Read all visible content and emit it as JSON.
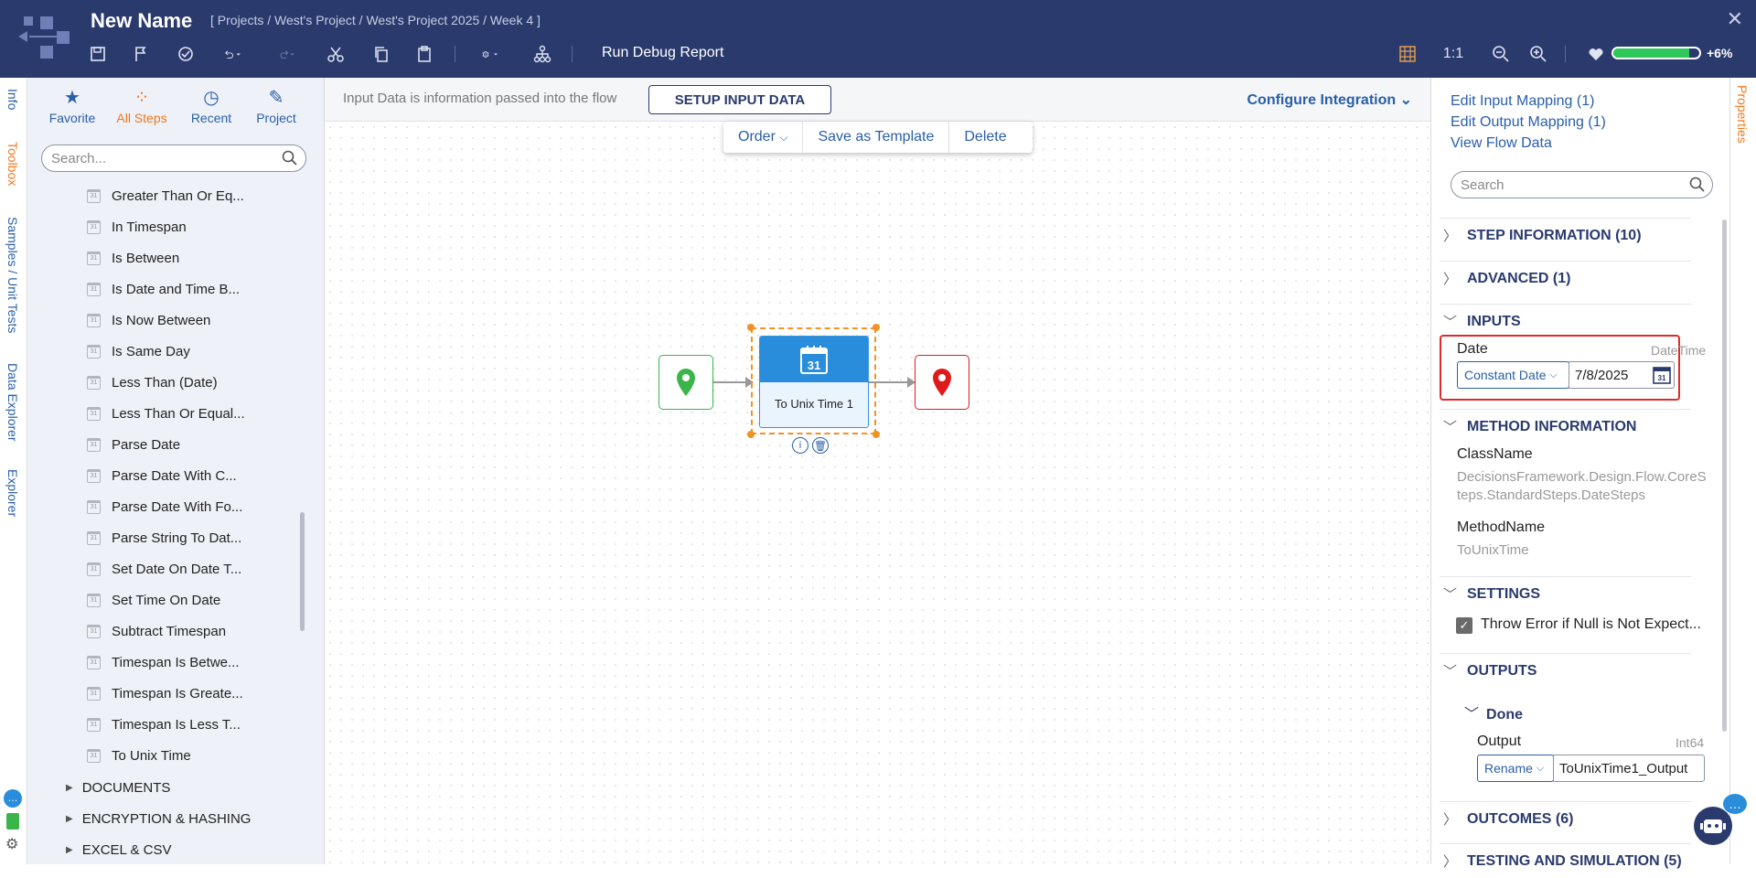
{
  "header": {
    "title": "New Name",
    "breadcrumb": "[ Projects / West's Project / West's Project 2025 / Week 4 ]",
    "run_debug": "Run Debug Report",
    "zoom_ratio": "1:1",
    "health_pct": "+6%",
    "health_fraction": 0.88
  },
  "left_tabs": [
    "Info",
    "Toolbox",
    "Samples / Unit Tests",
    "Data Explorer",
    "Explorer"
  ],
  "toolbox": {
    "categories": [
      {
        "label": "Favorite",
        "icon": "star-icon"
      },
      {
        "label": "All Steps",
        "icon": "all-steps-icon"
      },
      {
        "label": "Recent",
        "icon": "clock-icon"
      },
      {
        "label": "Project",
        "icon": "project-icon"
      }
    ],
    "search_placeholder": "Search...",
    "steps": [
      "Greater Than Or Eq...",
      "In Timespan",
      "Is Between",
      "Is Date and Time B...",
      "Is Now Between",
      "Is Same Day",
      "Less Than (Date)",
      "Less Than Or Equal...",
      "Parse Date",
      "Parse Date With C...",
      "Parse Date With Fo...",
      "Parse String To Dat...",
      "Set Date On Date T...",
      "Set Time On Date",
      "Subtract Timespan",
      "Timespan Is Betwe...",
      "Timespan Is Greate...",
      "Timespan Is Less T...",
      "To Unix Time"
    ],
    "groups": [
      "DOCUMENTS",
      "ENCRYPTION & HASHING",
      "EXCEL & CSV"
    ]
  },
  "canvas": {
    "input_info": "Input Data is information passed into the flow",
    "setup_button": "SETUP INPUT DATA",
    "configure": "Configure Integration",
    "float_toolbar": {
      "order": "Order",
      "save_template": "Save as Template",
      "delete": "Delete"
    },
    "step_label": "To Unix Time 1",
    "calendar_day": "31"
  },
  "properties": {
    "tab_label": "Properties",
    "links": [
      "Edit Input Mapping (1)",
      "Edit Output Mapping (1)",
      "View Flow Data"
    ],
    "search_placeholder": "Search",
    "sections": {
      "step_info": "STEP INFORMATION (10)",
      "advanced": "ADVANCED (1)",
      "inputs": "INPUTS",
      "method_info": "METHOD INFORMATION",
      "settings": "SETTINGS",
      "outputs": "OUTPUTS",
      "outcomes": "OUTCOMES (6)",
      "testing": "TESTING AND SIMULATION (5)"
    },
    "date_field": {
      "label": "Date",
      "type": "DateTime",
      "mode": "Constant Date",
      "value": "7/8/2025"
    },
    "class_name_label": "ClassName",
    "class_name_value": "DecisionsFramework.Design.Flow.CoreSteps.StandardSteps.DateSteps",
    "method_name_label": "MethodName",
    "method_name_value": "ToUnixTime",
    "setting_throw": "Throw Error if Null is Not Expect...",
    "done_label": "Done",
    "output_field": {
      "label": "Output",
      "type": "Int64",
      "mode": "Rename",
      "value": "ToUnixTime1_Output"
    }
  },
  "colors": {
    "header_bg": "#2a3a6d",
    "accent": "#2a5fa8",
    "selection": "#f29222",
    "start": "#3bb54a",
    "end": "#e01a1a",
    "highlight": "#e02a2a"
  }
}
